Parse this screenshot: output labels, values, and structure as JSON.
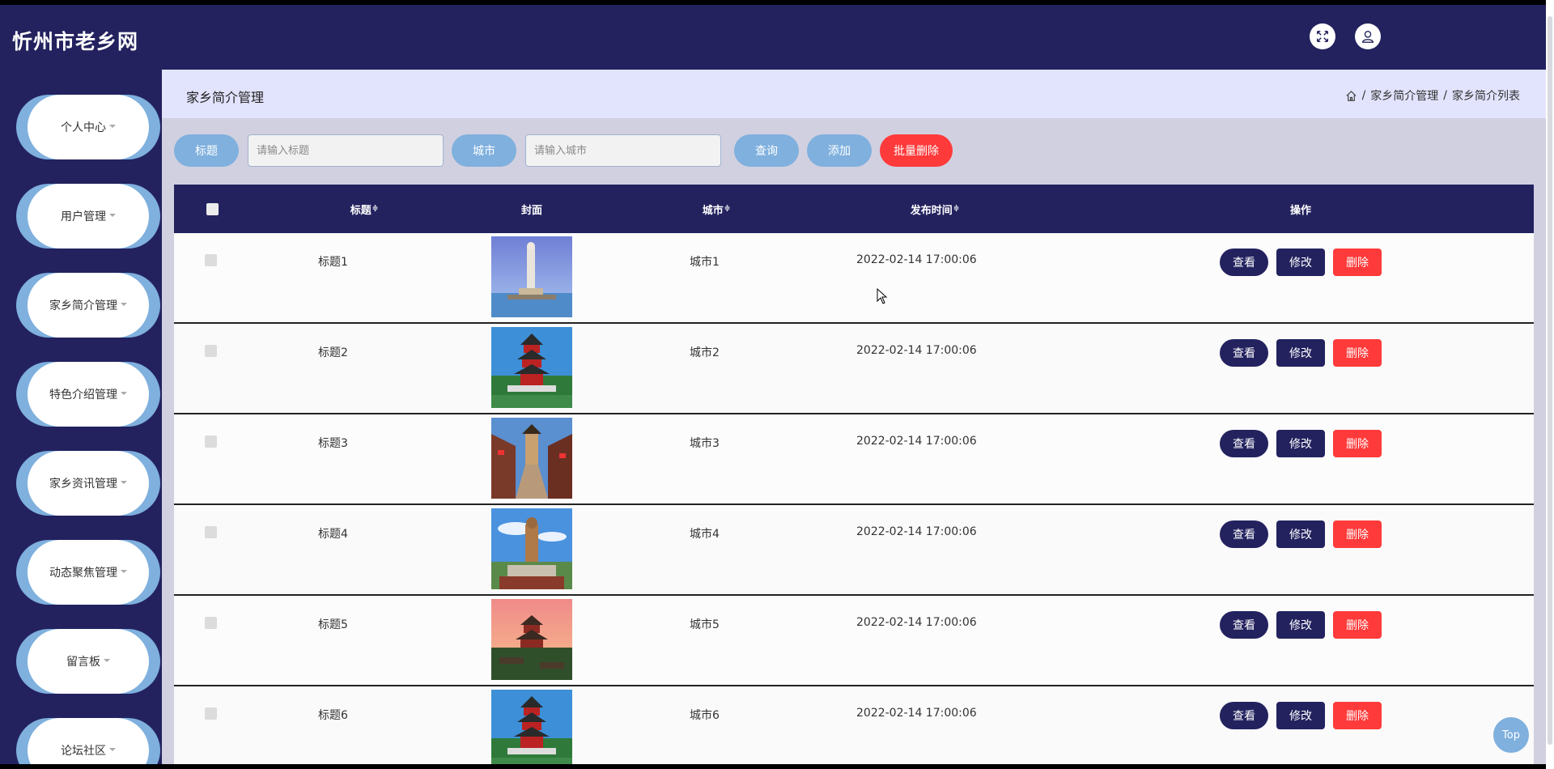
{
  "header": {
    "title": "忻州市老乡网",
    "fullscreen_icon": "fullscreen-icon",
    "user_icon": "user-icon"
  },
  "sidebar": {
    "items": [
      {
        "label": "个人中心"
      },
      {
        "label": "用户管理"
      },
      {
        "label": "家乡简介管理"
      },
      {
        "label": "特色介绍管理"
      },
      {
        "label": "家乡资讯管理"
      },
      {
        "label": "动态聚焦管理"
      },
      {
        "label": "留言板"
      },
      {
        "label": "论坛社区"
      }
    ]
  },
  "page": {
    "title": "家乡简介管理",
    "breadcrumb": [
      "家乡简介管理",
      "家乡简介列表"
    ],
    "separator": "/"
  },
  "search": {
    "title_label": "标题",
    "title_placeholder": "请输入标题",
    "city_label": "城市",
    "city_placeholder": "请输入城市",
    "query_button": "查询",
    "add_button": "添加",
    "batch_delete_button": "批量删除"
  },
  "table": {
    "headers": {
      "title": "标题",
      "cover": "封面",
      "city": "城市",
      "time": "发布时间",
      "ops": "操作",
      "sort_mark": "≑"
    },
    "rows": [
      {
        "title": "标题1",
        "city": "城市1",
        "time": "2022-02-14 17:00:06",
        "cover": "statue-sea"
      },
      {
        "title": "标题2",
        "city": "城市2",
        "time": "2022-02-14 17:00:06",
        "cover": "pagoda"
      },
      {
        "title": "标题3",
        "city": "城市3",
        "time": "2022-02-14 17:00:06",
        "cover": "street-tower"
      },
      {
        "title": "标题4",
        "city": "城市4",
        "time": "2022-02-14 17:00:06",
        "cover": "buddha-statue"
      },
      {
        "title": "标题5",
        "city": "城市5",
        "time": "2022-02-14 17:00:06",
        "cover": "pagoda-sunset"
      },
      {
        "title": "标题6",
        "city": "城市6",
        "time": "2022-02-14 17:00:06",
        "cover": "pagoda"
      }
    ],
    "ops": {
      "view": "查看",
      "edit": "修改",
      "delete": "删除"
    }
  },
  "top_button": "Top",
  "colors": {
    "navy": "#23225f",
    "accent_blue": "#7fb0de",
    "danger": "#ff3a3a",
    "crumb_bg": "#e2e3fc",
    "main_bg": "#d1d0e0"
  }
}
